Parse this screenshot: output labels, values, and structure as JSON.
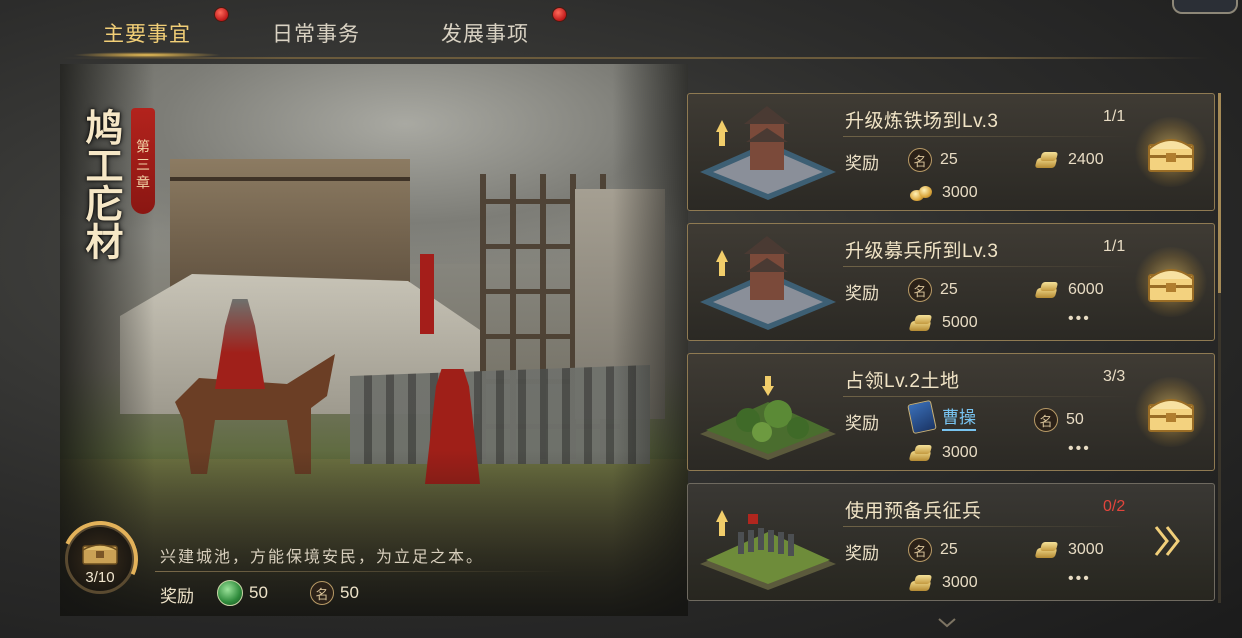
{
  "tabs": [
    {
      "label": "主要事宜",
      "active": true,
      "notify": true
    },
    {
      "label": "日常事务",
      "active": false,
      "notify": false
    },
    {
      "label": "发展事项",
      "active": false,
      "notify": true
    }
  ],
  "chapter": {
    "title": "鸠工庀材",
    "tag": "第三章",
    "progress": "3/10",
    "description": "兴建城池，方能保境安民，为立足之本。",
    "reward_label": "奖励",
    "rewards": [
      {
        "icon": "jade-icon",
        "amount": "50"
      },
      {
        "icon": "ming-icon",
        "amount": "50"
      }
    ]
  },
  "icons": {
    "ming_glyph": "名"
  },
  "quests": [
    {
      "title": "升级炼铁场到Lv.3",
      "count": "1/1",
      "count_color": "#e8dcc4",
      "reward_label": "奖励",
      "rewards": [
        {
          "icon": "ming-icon",
          "amount": "25"
        },
        {
          "icon": "gold-ingot-icon",
          "amount": "2400"
        },
        {
          "icon": "gold-nugget-icon",
          "amount": "3000"
        }
      ],
      "more": "",
      "action": "claim"
    },
    {
      "title": "升级募兵所到Lv.3",
      "count": "1/1",
      "count_color": "#e8dcc4",
      "reward_label": "奖励",
      "rewards": [
        {
          "icon": "ming-icon",
          "amount": "25"
        },
        {
          "icon": "gold-ingot-icon",
          "amount": "6000"
        },
        {
          "icon": "gold-ingot-icon",
          "amount": "5000"
        }
      ],
      "more": "•••",
      "action": "claim"
    },
    {
      "title": "占领Lv.2土地",
      "count": "3/3",
      "count_color": "#e8dcc4",
      "reward_label": "奖励",
      "rewards": [
        {
          "icon": "hero-card-icon",
          "amount": "曹操"
        },
        {
          "icon": "ming-icon",
          "amount": "50"
        },
        {
          "icon": "gold-ingot-icon",
          "amount": "3000"
        }
      ],
      "more": "•••",
      "action": "claim"
    },
    {
      "title": "使用预备兵征兵",
      "count": "0/2",
      "count_color": "#e2453c",
      "reward_label": "奖励",
      "rewards": [
        {
          "icon": "ming-icon",
          "amount": "25"
        },
        {
          "icon": "gold-ingot-icon",
          "amount": "3000"
        },
        {
          "icon": "gold-ingot-icon",
          "amount": "3000"
        }
      ],
      "more": "•••",
      "action": "go"
    }
  ],
  "colors": {
    "accent_gold": "#f2cf77",
    "border": "#8f7a52",
    "alert_red": "#e2453c"
  }
}
